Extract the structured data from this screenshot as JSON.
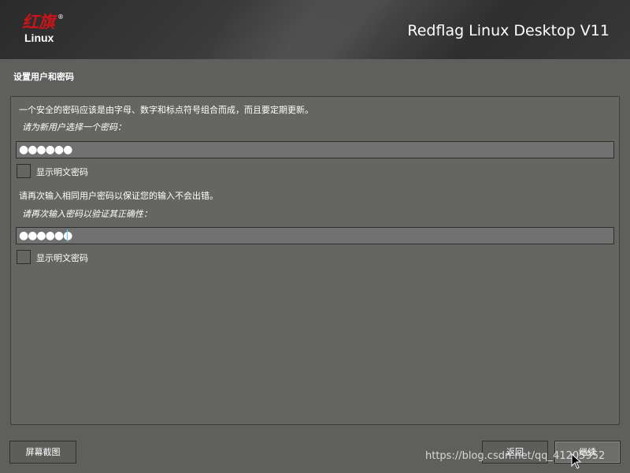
{
  "header": {
    "logo_cn": "红旗",
    "logo_en": "Linux",
    "logo_reg": "®",
    "product_name": "Redflag Linux Desktop V11"
  },
  "section": {
    "title": "设置用户和密码"
  },
  "form": {
    "intro": "一个安全的密码应该是由字母、数字和标点符号组合而成，而且要定期更新。",
    "password_prompt": "请为新用户选择一个密码：",
    "password_value": "●●●●●●",
    "show_password_label_1": "显示明文密码",
    "confirm_intro": "请再次输入相同用户密码以保证您的输入不会出错。",
    "confirm_prompt": "请再次输入密码以验证其正确性：",
    "confirm_value": "●●●●●●",
    "show_password_label_2": "显示明文密码",
    "show_password_checked_1": false,
    "show_password_checked_2": false
  },
  "footer": {
    "screenshot_button": "屏幕截图",
    "back_button": "返回",
    "continue_button": "继续"
  },
  "watermark": "https://blog.csdn.net/qq_41205952",
  "colors": {
    "background": "#5f605d",
    "logo_red": "#c8151b",
    "caret": "#4fd4ff"
  }
}
